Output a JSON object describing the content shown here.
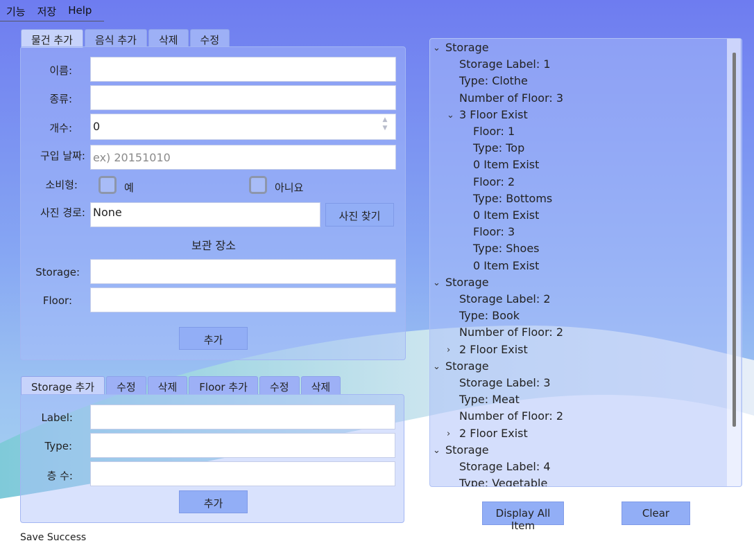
{
  "menu": [
    "기능",
    "저장",
    "Help"
  ],
  "item_tabs": [
    {
      "label": "물건 추가",
      "active": true
    },
    {
      "label": "음식 추가",
      "active": false
    },
    {
      "label": "삭제",
      "active": false
    },
    {
      "label": "수정",
      "active": false
    }
  ],
  "item_form": {
    "name_label": "이름:",
    "kind_label": "종류:",
    "count_label": "개수:",
    "count_value": "0",
    "date_label": "구입 날짜:",
    "date_placeholder": "ex) 20151010",
    "consumable_label": "소비형:",
    "yes_label": "예",
    "no_label": "아니요",
    "photo_label": "사진 경로:",
    "photo_value": "None",
    "photo_button": "사진 찾기",
    "section_title": "보관 장소",
    "storage_label": "Storage:",
    "floor_label": "Floor:",
    "add_button": "추가"
  },
  "storage_tabs": [
    {
      "label": "Storage 추가",
      "active": true
    },
    {
      "label": "수정",
      "active": false
    },
    {
      "label": "삭제",
      "active": false
    },
    {
      "label": "Floor 추가",
      "active": false
    },
    {
      "label": "수정",
      "active": false
    },
    {
      "label": "삭제",
      "active": false
    }
  ],
  "storage_form": {
    "label_label": "Label:",
    "type_label": "Type:",
    "floors_label": "층 수:",
    "add_button": "추가"
  },
  "tree": [
    {
      "text": "Storage",
      "level": 0,
      "arrow": "expanded"
    },
    {
      "text": "Storage Label: 1",
      "level": 1
    },
    {
      "text": "Type: Clothe",
      "level": 1
    },
    {
      "text": "Number of Floor: 3",
      "level": 1
    },
    {
      "text": "3 Floor Exist",
      "level": 1,
      "arrow": "expanded"
    },
    {
      "text": "Floor: 1",
      "level": 2
    },
    {
      "text": "Type: Top",
      "level": 2
    },
    {
      "text": "0 Item Exist",
      "level": 2
    },
    {
      "text": "Floor: 2",
      "level": 2
    },
    {
      "text": "Type: Bottoms",
      "level": 2
    },
    {
      "text": "0 Item Exist",
      "level": 2
    },
    {
      "text": "Floor: 3",
      "level": 2
    },
    {
      "text": "Type: Shoes",
      "level": 2
    },
    {
      "text": "0 Item Exist",
      "level": 2
    },
    {
      "text": "Storage",
      "level": 0,
      "arrow": "expanded"
    },
    {
      "text": "Storage Label: 2",
      "level": 1
    },
    {
      "text": "Type: Book",
      "level": 1
    },
    {
      "text": "Number of Floor: 2",
      "level": 1
    },
    {
      "text": "2 Floor Exist",
      "level": 1,
      "arrow": "collapsed"
    },
    {
      "text": "Storage",
      "level": 0,
      "arrow": "expanded"
    },
    {
      "text": "Storage Label: 3",
      "level": 1
    },
    {
      "text": "Type: Meat",
      "level": 1
    },
    {
      "text": "Number of Floor: 2",
      "level": 1
    },
    {
      "text": "2 Floor Exist",
      "level": 1,
      "arrow": "collapsed"
    },
    {
      "text": "Storage",
      "level": 0,
      "arrow": "expanded"
    },
    {
      "text": "Storage Label: 4",
      "level": 1
    },
    {
      "text": "Type: Vegetable",
      "level": 1
    }
  ],
  "buttons": {
    "display_all": "Display All Item",
    "clear": "Clear"
  },
  "status": "Save Success",
  "colors": {
    "background_top": "#6f7df0",
    "background_bottom": "#ffffff",
    "button": "#92aef6"
  }
}
